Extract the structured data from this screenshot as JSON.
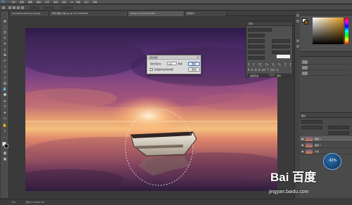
{
  "app": {
    "logo": "Ps",
    "menu": [
      "文件",
      "编辑",
      "图像",
      "图层",
      "文字",
      "选择",
      "滤镜",
      "3D",
      "视图",
      "窗口",
      "帮助"
    ]
  },
  "tabs": [
    {
      "label": "photoshop-boat-sunset.jpg",
      "active": false
    },
    {
      "label": "夕阳-海面-小船.jpg @ 33.3%(RGB/8)",
      "active": false
    },
    {
      "label": "photo-room.psd @ 50%",
      "active": true
    },
    {
      "label": "未标题-1",
      "active": false
    }
  ],
  "status": {
    "zoom": "33%",
    "doc": "文档:13.2M/26.4M"
  },
  "dialog": {
    "title": "羽化选区",
    "radius_label": "羽化半径(R):",
    "radius_value": "100",
    "unit": "像素",
    "checkbox_label": "应用画布边界的效果",
    "ok": "确定",
    "cancel": "取消",
    "close_glyph": "×"
  },
  "char_panel": {
    "title": "字符",
    "glyphs_row1": [
      "T",
      "T",
      "TT",
      "Tт",
      "T¹",
      "T₁",
      "T",
      "T"
    ],
    "glyphs_row2": [
      "fi",
      "ơ",
      "st",
      "A",
      "ad",
      "T",
      "1st",
      "½"
    ],
    "language": "美国英语",
    "antialias": "锐利"
  },
  "layers": {
    "tab": "图层",
    "items": [
      {
        "name": "图层 1",
        "selected": true
      },
      {
        "name": "图层 1",
        "selected": false
      },
      {
        "name": "背景",
        "selected": false
      }
    ]
  },
  "widget": {
    "value": "43%"
  },
  "watermark": {
    "brand": "Bai 百度",
    "url": "jingyan.baidu.com"
  },
  "colors": {
    "accent": "#31a8ff",
    "foreground": "#f2f2f2",
    "background": "#8a5a1d"
  }
}
